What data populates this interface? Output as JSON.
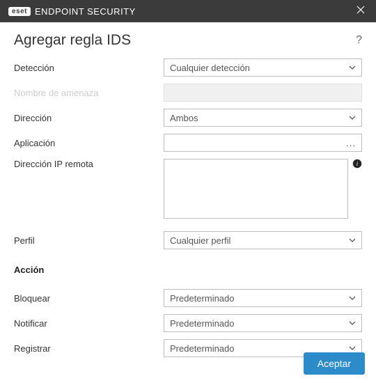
{
  "titlebar": {
    "brand_badge": "eset",
    "brand_text": "ENDPOINT SECURITY"
  },
  "header": {
    "title": "Agregar regla IDS"
  },
  "fields": {
    "detection": {
      "label": "Detección",
      "value": "Cualquier detección"
    },
    "threat_name": {
      "label": "Nombre de amenaza",
      "value": ""
    },
    "direction": {
      "label": "Dirección",
      "value": "Ambos"
    },
    "application": {
      "label": "Aplicación",
      "value": ""
    },
    "remote_ip": {
      "label": "Dirección IP remota",
      "value": ""
    },
    "profile": {
      "label": "Perfil",
      "value": "Cualquier perfil"
    }
  },
  "action_section": {
    "heading": "Acción",
    "block": {
      "label": "Bloquear",
      "value": "Predeterminado"
    },
    "notify": {
      "label": "Notificar",
      "value": "Predeterminado"
    },
    "log": {
      "label": "Registrar",
      "value": "Predeterminado"
    }
  },
  "footer": {
    "accept": "Aceptar"
  }
}
